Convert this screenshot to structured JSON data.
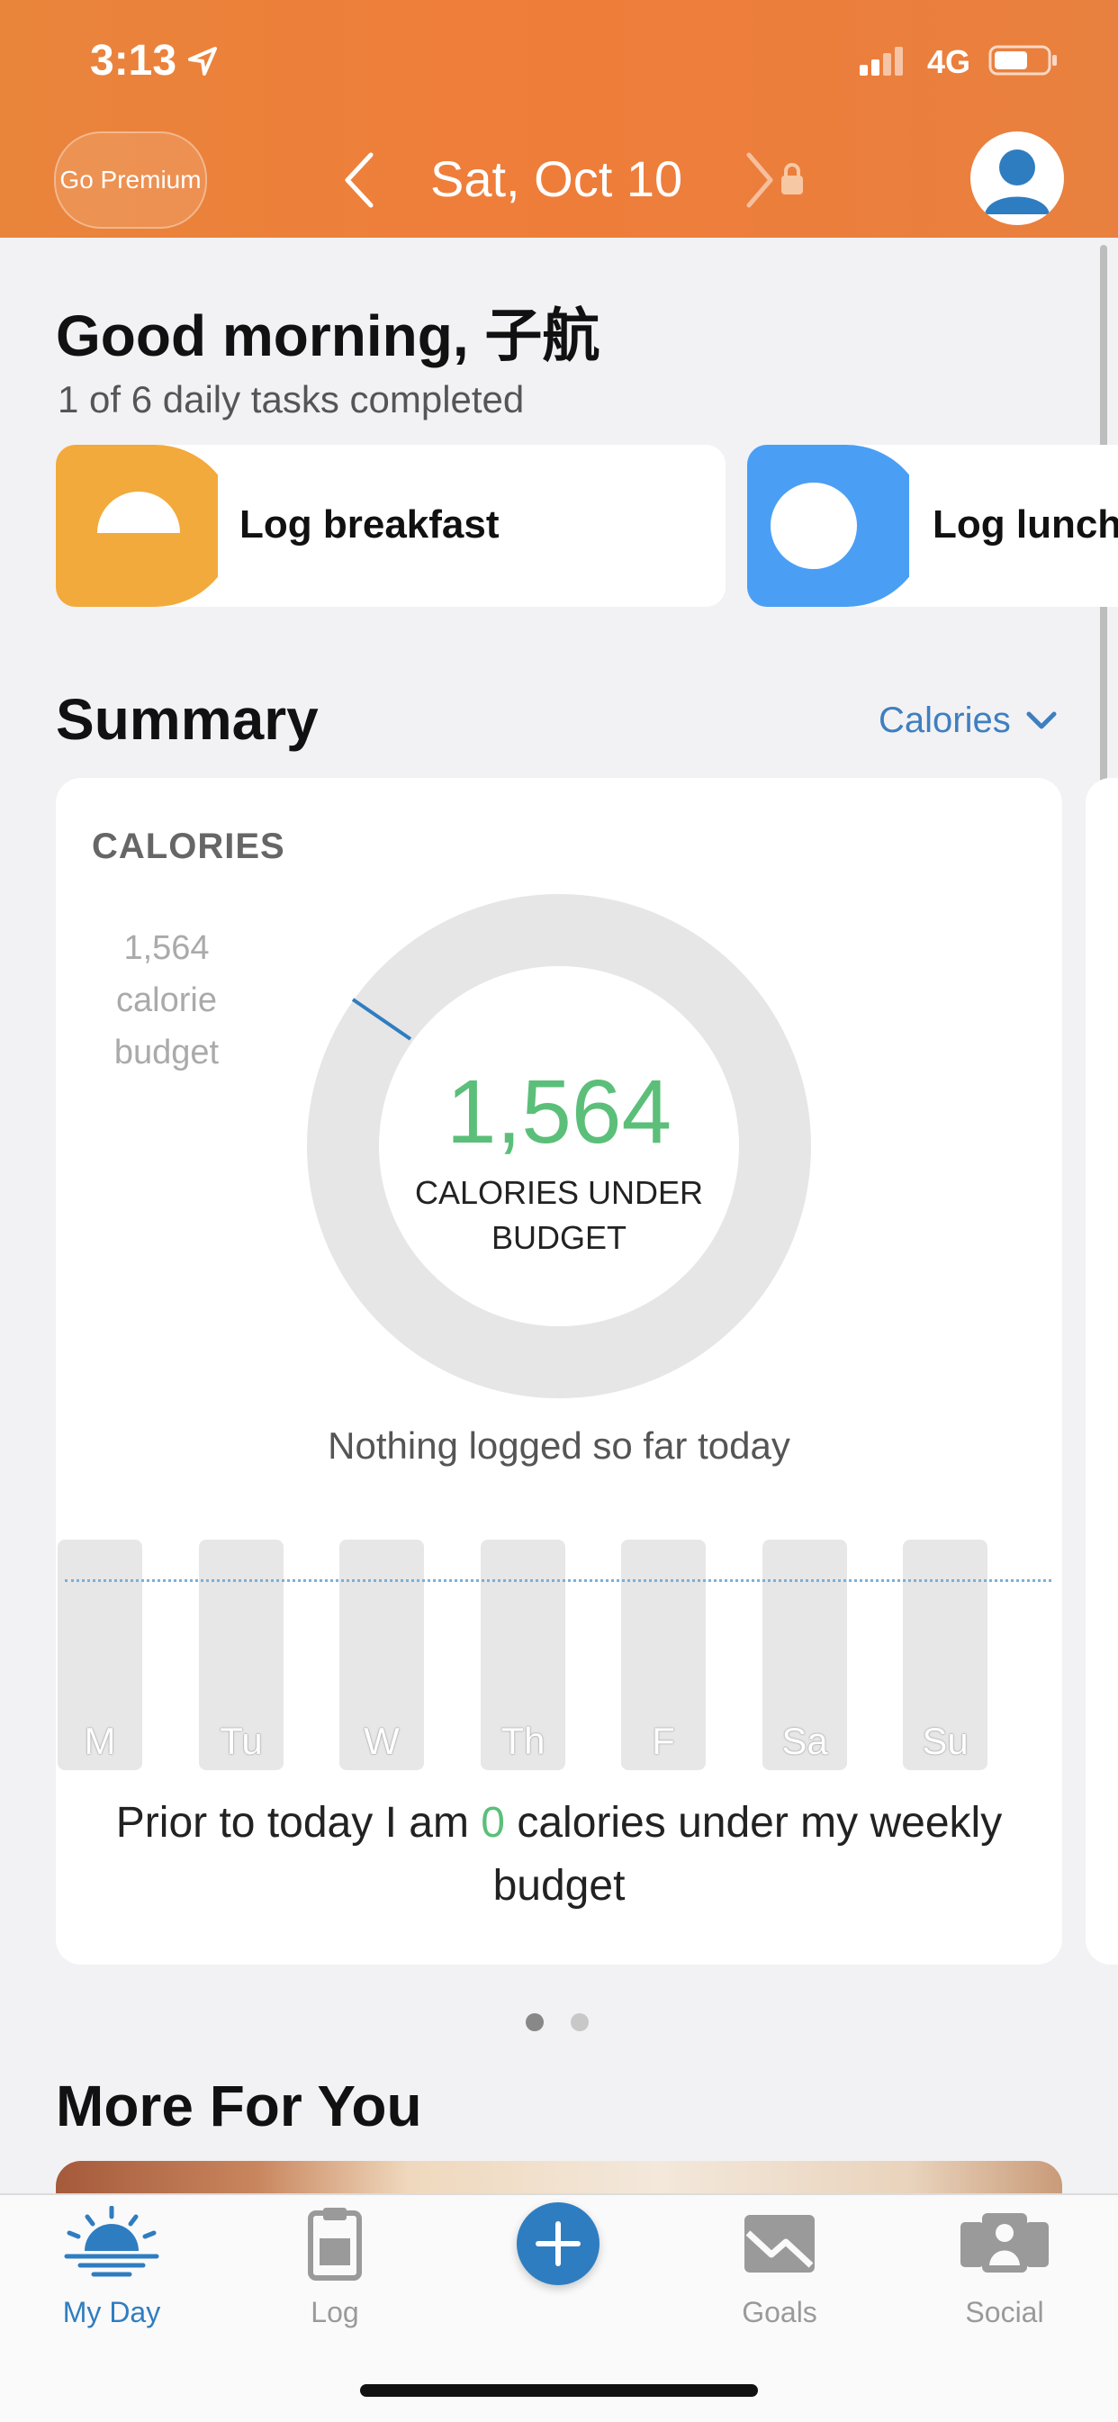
{
  "status_bar": {
    "time": "3:13",
    "network": "4G"
  },
  "header": {
    "premium_label": "Go Premium",
    "date": "Sat, Oct 10"
  },
  "greeting": {
    "title": "Good morning, 子航",
    "tasks_progress": "1 of 6 daily tasks completed"
  },
  "tasks": [
    {
      "label": "Log breakfast",
      "color": "#f2aa3c"
    },
    {
      "label": "Log lunch",
      "color": "#4a9ff5"
    }
  ],
  "summary": {
    "title": "Summary",
    "metric_selector": "Calories",
    "card_heading": "CALORIES",
    "budget_note": "1,564 calorie budget",
    "remaining_value": "1,564",
    "remaining_label": "CALORIES UNDER BUDGET",
    "consumed_fraction": 0,
    "empty_message": "Nothing logged so far today",
    "week_days": [
      "M",
      "Tu",
      "W",
      "Th",
      "F",
      "Sa",
      "Su"
    ],
    "weekly_prefix": "Prior to today I am",
    "weekly_value": "0",
    "weekly_suffix": "calories under my weekly budget",
    "page_dots": {
      "count": 2,
      "active": 0
    }
  },
  "more": {
    "title": "More For You"
  },
  "tabbar": {
    "tabs": [
      {
        "label": "My Day",
        "icon": "sunrise-icon",
        "active": true
      },
      {
        "label": "Log",
        "icon": "clipboard-icon",
        "active": false
      },
      {
        "label": "",
        "icon": "plus-icon",
        "active": false
      },
      {
        "label": "Goals",
        "icon": "chart-icon",
        "active": false
      },
      {
        "label": "Social",
        "icon": "people-icon",
        "active": false
      }
    ]
  },
  "colors": {
    "header": "#ec7f3b",
    "accent_blue": "#2f7dc1",
    "success_green": "#5bbf7a"
  }
}
